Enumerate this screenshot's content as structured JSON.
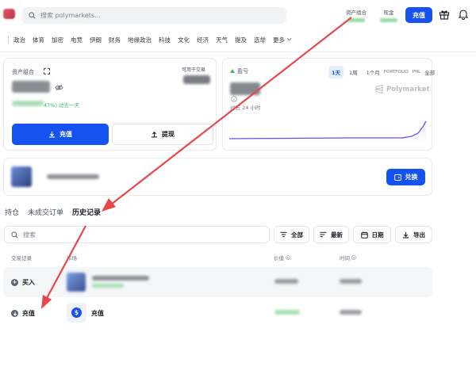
{
  "header": {
    "search_placeholder": "搜索 polymarkets...",
    "portfolio_label": "资产组合",
    "cash_label": "现金",
    "deposit_label": "充值"
  },
  "nav": {
    "items": [
      "政治",
      "体育",
      "加密",
      "电竞",
      "伊朗",
      "财务",
      "地缘政治",
      "科技",
      "文化",
      "经济",
      "天气",
      "提及",
      "选举",
      "更多"
    ]
  },
  "portfolio": {
    "title": "资产组合",
    "available_label": "可用于交易",
    "change_text": "47%) 过去一天",
    "deposit_button": "充值",
    "withdraw_button": "提现"
  },
  "profit": {
    "title": "盈亏",
    "ranges": [
      "1天",
      "1周",
      "1个月",
      "PORTFOLIO",
      "PNL",
      "全部"
    ],
    "active_range": "1天",
    "period_label": "过去 24 小时",
    "watermark": "Polymarket",
    "chart_line_color": "#6f4cf0"
  },
  "account": {
    "exchange_button": "兑换"
  },
  "history": {
    "tabs": [
      "持仓",
      "未成交订单",
      "历史记录"
    ],
    "active_tab": "历史记录",
    "search_placeholder": "搜索",
    "filter_all": "全部",
    "sort_latest": "最新",
    "date_button": "日期",
    "export_button": "导出",
    "columns": [
      "交易记录",
      "市场",
      "价值",
      "时间"
    ],
    "rows": [
      {
        "action": "买入",
        "action_icon": "plus-icon",
        "market": ""
      },
      {
        "action": "充值",
        "action_icon": "arrow-down-icon",
        "market": "充值",
        "market_icon": "dollar-icon"
      }
    ]
  },
  "colors": {
    "accent": "#1652f0",
    "annotation_arrow": "#e8474a",
    "positive": "#2ebd5f"
  }
}
